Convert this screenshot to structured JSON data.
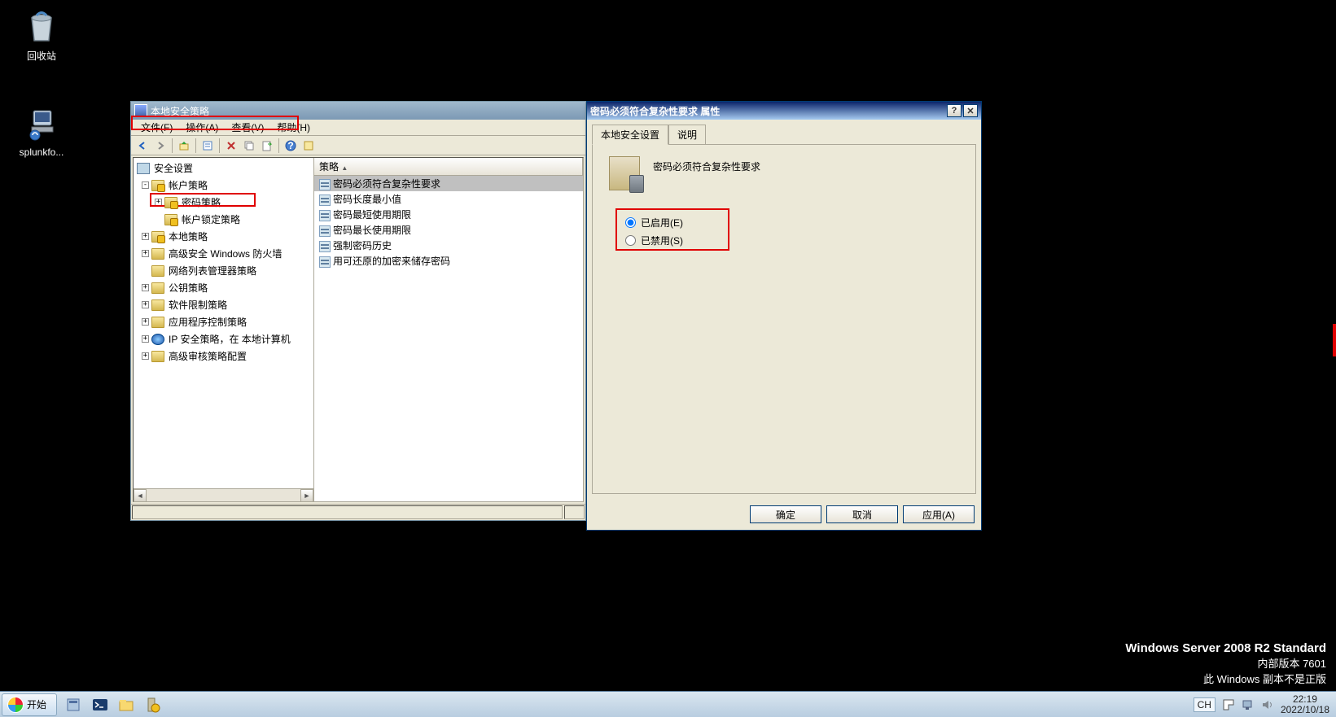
{
  "desktop": {
    "recycle_bin": "回收站",
    "splunk": "splunkfo..."
  },
  "main_window": {
    "title": "本地安全策略",
    "menus": [
      "文件(F)",
      "操作(A)",
      "查看(V)",
      "帮助(H)"
    ],
    "tree": {
      "root": "安全设置",
      "account_policy": "帐户策略",
      "password_policy": "密码策略",
      "lockout_policy": "帐户锁定策略",
      "local_policy": "本地策略",
      "adv_firewall": "高级安全 Windows 防火墙",
      "network_list": "网络列表管理器策略",
      "public_key": "公钥策略",
      "software_restrict": "软件限制策略",
      "app_control": "应用程序控制策略",
      "ip_security": "IP 安全策略，在 本地计算机",
      "adv_audit": "高级审核策略配置"
    },
    "list": {
      "header_policy": "策略",
      "rows": [
        "密码必须符合复杂性要求",
        "密码长度最小值",
        "密码最短使用期限",
        "密码最长使用期限",
        "强制密码历史",
        "用可还原的加密来储存密码"
      ]
    }
  },
  "dialog": {
    "title": "密码必须符合复杂性要求 属性",
    "tab_setting": "本地安全设置",
    "tab_explain": "说明",
    "policy_name": "密码必须符合复杂性要求",
    "radio_enabled": "已启用(E)",
    "radio_disabled": "已禁用(S)",
    "btn_ok": "确定",
    "btn_cancel": "取消",
    "btn_apply": "应用(A)"
  },
  "watermark": {
    "line1": "Windows Server 2008 R2 Standard",
    "line2": "内部版本 7601",
    "line3": "此 Windows 副本不是正版"
  },
  "taskbar": {
    "start": "开始",
    "lang": "CH",
    "time": "22:19",
    "date": "2022/10/18"
  }
}
